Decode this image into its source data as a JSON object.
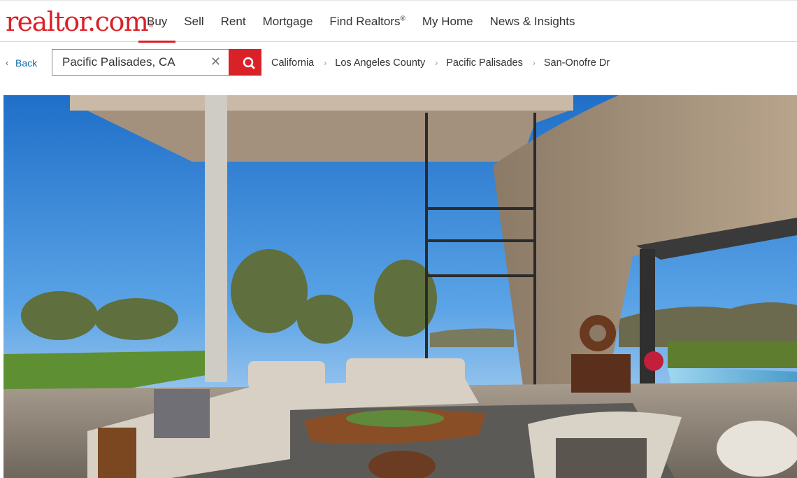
{
  "brand": {
    "logo_text": "realtor.com",
    "logo_mark": "®",
    "color": "#d92228"
  },
  "nav": {
    "items": [
      {
        "label": "Buy",
        "active": true
      },
      {
        "label": "Sell"
      },
      {
        "label": "Rent"
      },
      {
        "label": "Mortgage"
      },
      {
        "label": "Find Realtors",
        "sup": "®"
      },
      {
        "label": "My Home"
      },
      {
        "label": "News & Insights"
      }
    ]
  },
  "subnav": {
    "back_label": "Back",
    "search": {
      "value": "Pacific Palisades, CA",
      "placeholder": ""
    },
    "breadcrumbs": [
      "California",
      "Los Angeles County",
      "Pacific Palisades",
      "San-Onofre Dr"
    ]
  },
  "icons": {
    "back": "chevron-left-icon",
    "clear": "close-icon",
    "search": "search-icon",
    "separator": "chevron-right-icon"
  },
  "photo": {
    "subject": "listing photo - open-air living room with ocean view"
  }
}
